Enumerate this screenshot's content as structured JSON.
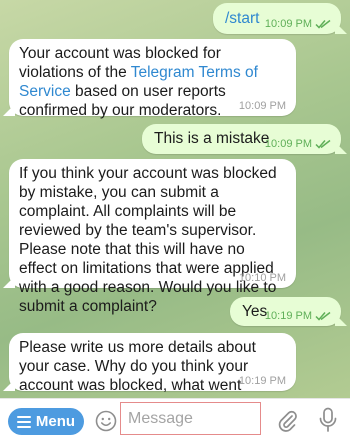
{
  "messages": [
    {
      "direction": "out",
      "text": "/start",
      "time": "10:09 PM",
      "status_icon": "double-check-icon"
    },
    {
      "direction": "in",
      "text_before": "Your account was blocked for violations of the ",
      "link_text": "Telegram Terms of Service",
      "text_after": " based on user reports confirmed by our moderators.",
      "time": "10:09 PM"
    },
    {
      "direction": "out",
      "text": "This is a mistake",
      "time": "10:09 PM",
      "status_icon": "double-check-icon"
    },
    {
      "direction": "in",
      "text": "If you think your account was blocked by mistake, you can submit a complaint. All complaints will be reviewed by the team's supervisor. Please note that this will have no effect on limitations that were applied with a good reason. Would you like to submit a complaint?",
      "time": "10:10 PM"
    },
    {
      "direction": "out",
      "text": "Yes",
      "time": "10:19 PM",
      "status_icon": "double-check-icon"
    },
    {
      "direction": "in",
      "text": "Please write us more details about your case. Why do you think your account was blocked, what went wrong?",
      "time": "10:19 PM"
    }
  ],
  "input_bar": {
    "menu_label": "Menu",
    "placeholder": "Message",
    "icons": [
      "menu-icon",
      "emoji-icon",
      "attach-icon",
      "microphone-icon"
    ]
  },
  "colors": {
    "outgoing_bubble": "#e7fdd5",
    "incoming_bubble": "#ffffff",
    "link": "#2f88d0",
    "menu_button": "#4d9be0",
    "outgoing_meta": "#5faf58",
    "input_highlight": "#e58b8b"
  }
}
